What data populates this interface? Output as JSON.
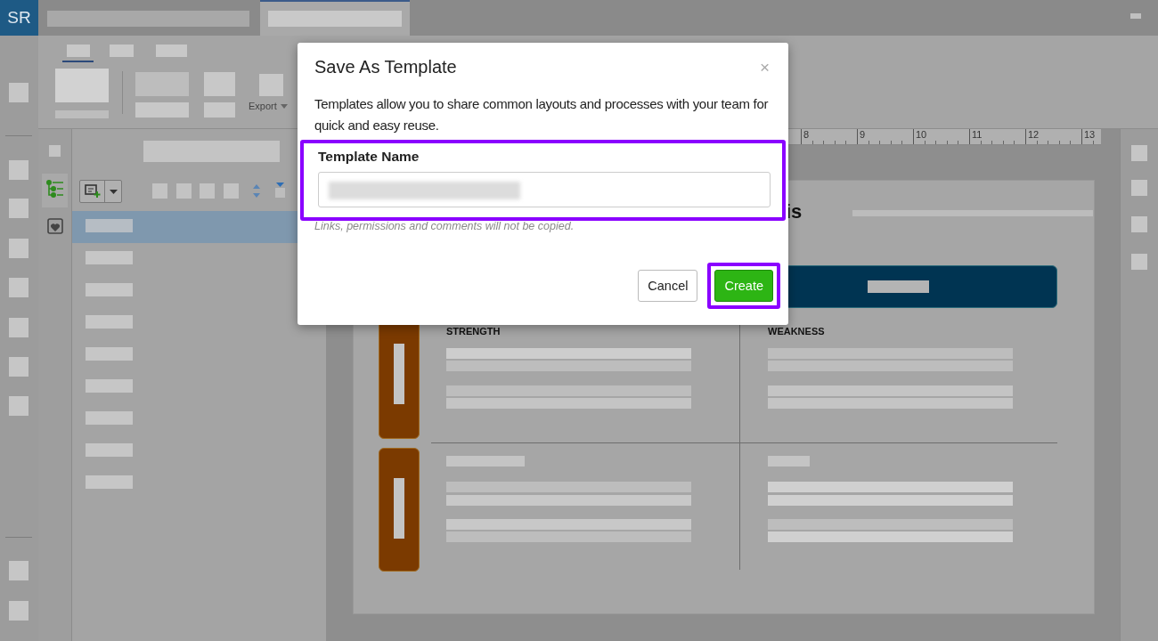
{
  "app": {
    "avatar": "SR"
  },
  "ribbon": {
    "export_label": "Export"
  },
  "outline": {
    "items": [
      {
        "selected": true
      },
      {
        "selected": false
      },
      {
        "selected": false
      },
      {
        "selected": false
      },
      {
        "selected": false
      },
      {
        "selected": false
      },
      {
        "selected": false
      },
      {
        "selected": false
      },
      {
        "selected": false
      }
    ]
  },
  "ruler": {
    "labels": [
      "8",
      "9",
      "10",
      "11",
      "12",
      "13"
    ]
  },
  "canvas": {
    "title_fragment": "is",
    "quadrants": [
      {
        "heading": "STRENGTH"
      },
      {
        "heading": "WEAKNESS"
      }
    ]
  },
  "dialog": {
    "title": "Save As Template",
    "close": "×",
    "description": "Templates allow you to share common layouts and processes with your team for quick and easy reuse.",
    "field": {
      "label": "Template Name",
      "note": "Links, permissions and comments will not be copied.",
      "highlighted": true
    },
    "buttons": [
      {
        "label": "Cancel",
        "kind": "secondary",
        "highlighted": false
      },
      {
        "label": "Create",
        "kind": "primary",
        "highlighted": true
      }
    ]
  }
}
